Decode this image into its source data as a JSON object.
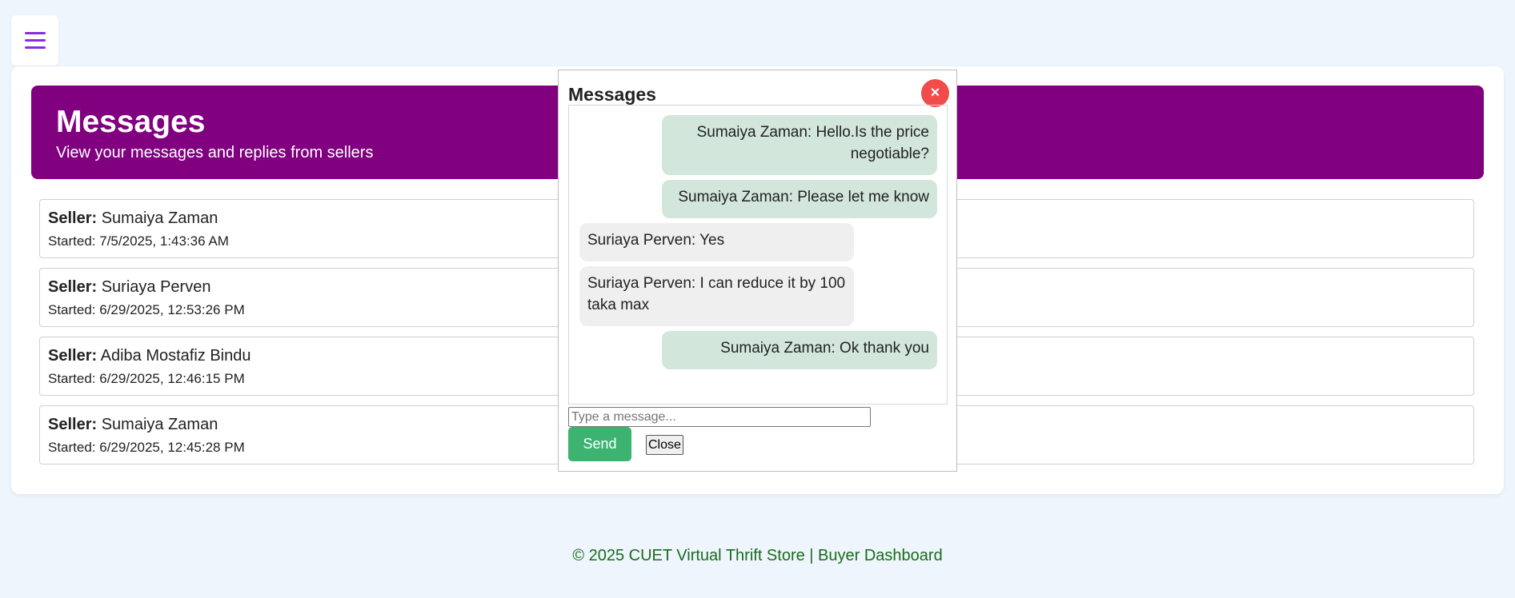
{
  "page": {
    "background": "#eef5fd"
  },
  "menu": {
    "icon": "hamburger-icon",
    "color": "#8a2be2"
  },
  "banner": {
    "title": "Messages",
    "subtitle": "View your messages and replies from sellers",
    "background": "#800080"
  },
  "threads": [
    {
      "seller_label": "Seller:",
      "seller": "Sumaiya Zaman",
      "started": "Started: 7/5/2025, 1:43:36 AM"
    },
    {
      "seller_label": "Seller:",
      "seller": "Suriaya Perven",
      "started": "Started: 6/29/2025, 12:53:26 PM"
    },
    {
      "seller_label": "Seller:",
      "seller": "Adiba Mostafiz Bindu",
      "started": "Started: 6/29/2025, 12:46:15 PM"
    },
    {
      "seller_label": "Seller:",
      "seller": "Sumaiya Zaman",
      "started": "Started: 6/29/2025, 12:45:28 PM"
    }
  ],
  "modal": {
    "title": "Messages",
    "close_x": "×",
    "messages": [
      {
        "direction": "out",
        "text": "Sumaiya Zaman: Hello.Is the price negotiable?"
      },
      {
        "direction": "out",
        "text": "Sumaiya Zaman: Please let me know"
      },
      {
        "direction": "in",
        "text": "Suriaya Perven: Yes"
      },
      {
        "direction": "in",
        "text": "Suriaya Perven: I can reduce it by 100 taka max"
      },
      {
        "direction": "out",
        "text": "Sumaiya Zaman: Ok thank you"
      }
    ],
    "input_placeholder": "Type a message...",
    "input_value": "",
    "send_label": "Send",
    "close_label": "Close",
    "send_color": "#3cb371",
    "close_x_color": "#f14b4b"
  },
  "footer": {
    "text": "© 2025 CUET Virtual Thrift Store | Buyer Dashboard",
    "color": "#1a6b1a"
  }
}
